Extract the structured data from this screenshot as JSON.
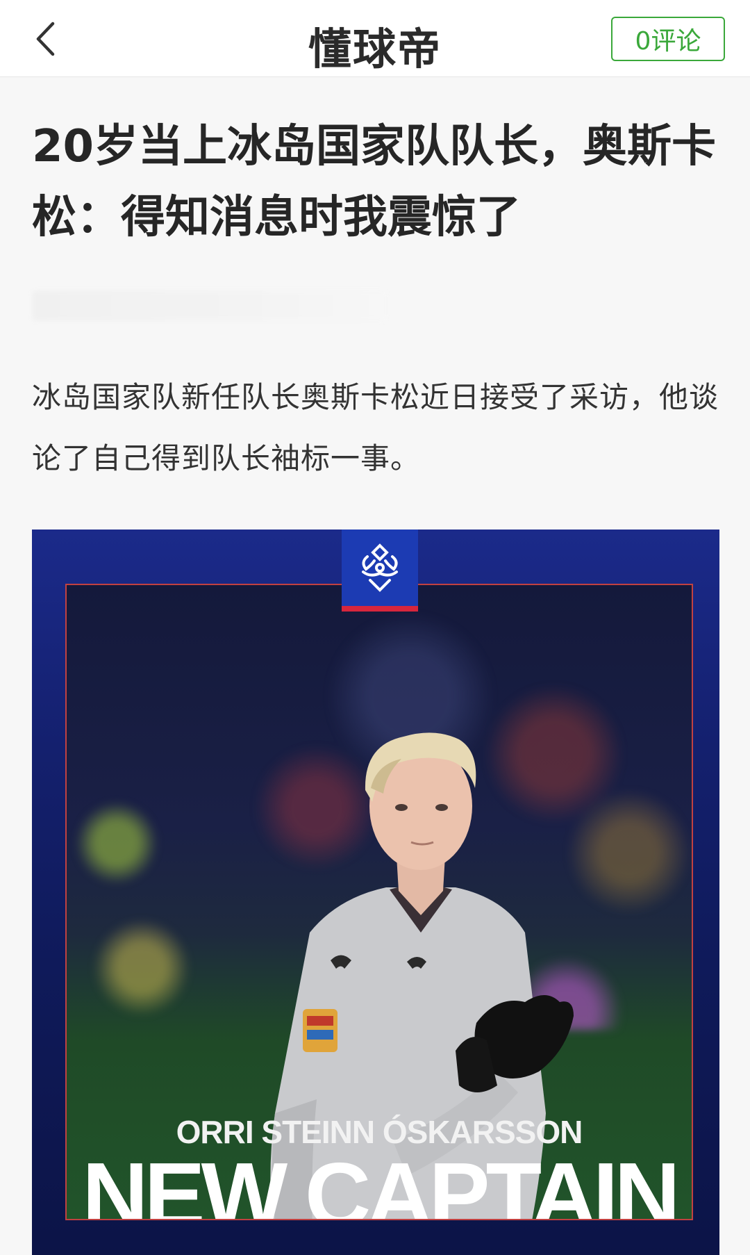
{
  "header": {
    "app_title": "懂球帝",
    "comment_label": "0评论",
    "back_icon": "chevron-left-icon"
  },
  "article": {
    "title": "20岁当上冰岛国家队队长，奥斯卡松：得知消息时我震惊了",
    "lead": "冰岛国家队新任队长奥斯卡松近日接受了采访，他谈论了自己得到队长袖标一事。"
  },
  "poster": {
    "player_name": "ORRI STEINN ÓSKARSSON",
    "headline": "NEW CAPTAIN",
    "logo_icon": "iceland-federation-logo-icon",
    "colors": {
      "frame": "#c24141",
      "accent_blue": "#1c3bb3",
      "accent_red": "#d7263d"
    }
  },
  "colors": {
    "comment_green": "#3aa83a"
  }
}
